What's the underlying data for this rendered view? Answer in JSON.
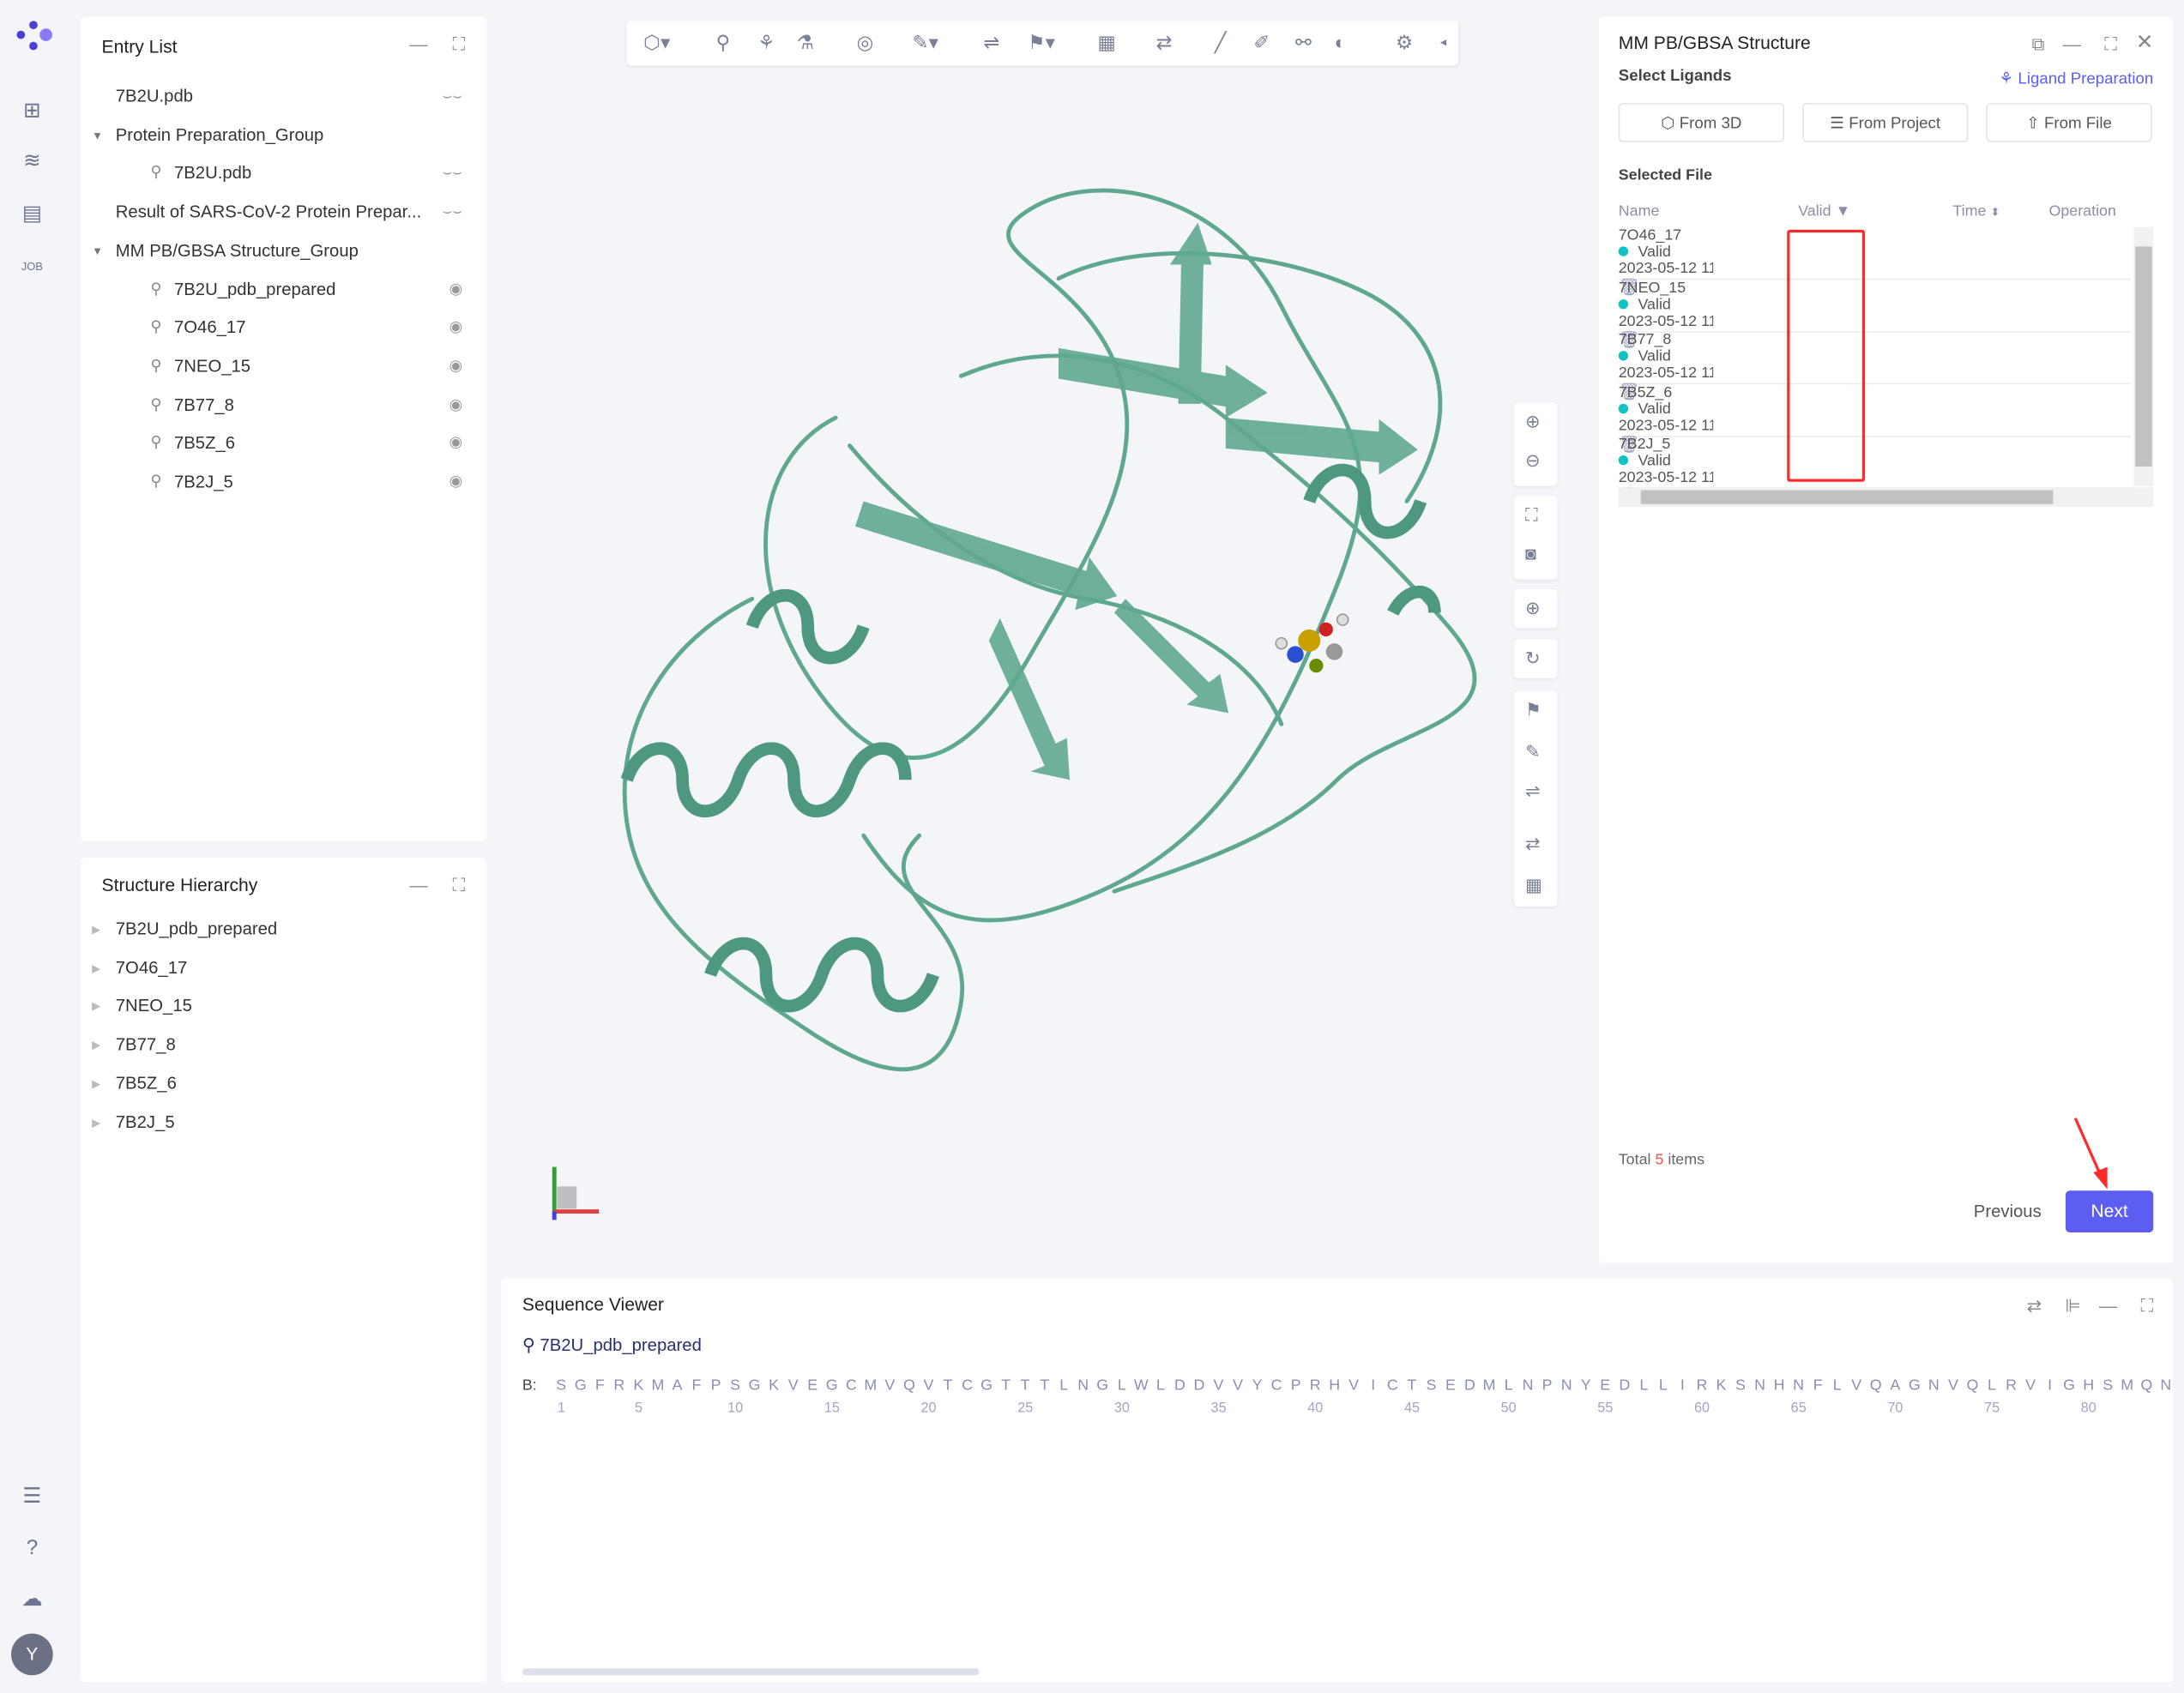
{
  "nav": {
    "icons": [
      "logo-icon",
      "new-file-icon",
      "layers-icon",
      "table-icon",
      "job-icon",
      "list-icon",
      "help-icon",
      "cloud-icon"
    ],
    "avatar": "Y",
    "job": "JOB"
  },
  "entry_list": {
    "title": "Entry List",
    "items": [
      {
        "label": "7B2U.pdb",
        "level": 0,
        "visible": false
      },
      {
        "label": "Protein Preparation_Group",
        "level": 0,
        "group": true
      },
      {
        "label": "7B2U.pdb",
        "level": 1,
        "visible": false
      },
      {
        "label": "Result of SARS-CoV-2 Protein Prepar...",
        "level": 0,
        "visible": false
      },
      {
        "label": "MM PB/GBSA Structure_Group",
        "level": 0,
        "group": true
      },
      {
        "label": "7B2U_pdb_prepared",
        "level": 1,
        "visible": true
      },
      {
        "label": "7O46_17",
        "level": 1,
        "visible": true
      },
      {
        "label": "7NEO_15",
        "level": 1,
        "visible": true
      },
      {
        "label": "7B77_8",
        "level": 1,
        "visible": true
      },
      {
        "label": "7B5Z_6",
        "level": 1,
        "visible": true
      },
      {
        "label": "7B2J_5",
        "level": 1,
        "visible": true
      }
    ]
  },
  "structure_hierarchy": {
    "title": "Structure Hierarchy",
    "items": [
      "7B2U_pdb_prepared",
      "7O46_17",
      "7NEO_15",
      "7B77_8",
      "7B5Z_6",
      "7B2J_5"
    ]
  },
  "viewer": {
    "protein_color": "#5fa88f"
  },
  "mmpbsa": {
    "title": "MM PB/GBSA Structure",
    "select_ligands": "Select Ligands",
    "ligand_prep": "Ligand Preparation",
    "buttons": [
      "From 3D",
      "From Project",
      "From File"
    ],
    "selected_file": "Selected File",
    "columns": [
      "Name",
      "Valid",
      "Time",
      "Operation"
    ],
    "rows": [
      {
        "name": "7O46_17",
        "valid": "Valid",
        "time": "2023-05-12 11"
      },
      {
        "name": "7NEO_15",
        "valid": "Valid",
        "time": "2023-05-12 11"
      },
      {
        "name": "7B77_8",
        "valid": "Valid",
        "time": "2023-05-12 11"
      },
      {
        "name": "7B5Z_6",
        "valid": "Valid",
        "time": "2023-05-12 11"
      },
      {
        "name": "7B2J_5",
        "valid": "Valid",
        "time": "2023-05-12 11"
      }
    ],
    "total_prefix": "Total",
    "total_count": "5",
    "total_suffix": "items",
    "previous": "Previous",
    "next": "Next",
    "accent": "#5b5ef0",
    "valid_color": "#12c2c2",
    "highlight": "#ff2a2a"
  },
  "sequence": {
    "title": "Sequence Viewer",
    "entry": "7B2U_pdb_prepared",
    "chain": "B:",
    "residues": "SGFRKMAFPSGKVEGCMVQVTCGTTTLNGLWLDDVVYCPRHVICTSEDMLNPNYEDLLIRKSNHNFLVQAGNVQLRVIGHSMQN",
    "ticks": [
      "1",
      "5",
      "10",
      "15",
      "20",
      "25",
      "30",
      "35",
      "40",
      "45",
      "50",
      "55",
      "60",
      "65",
      "70",
      "75",
      "80"
    ]
  }
}
